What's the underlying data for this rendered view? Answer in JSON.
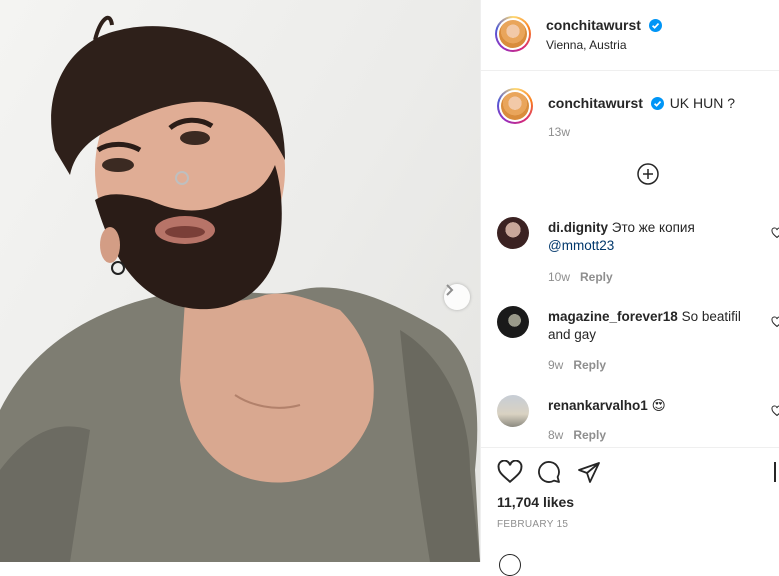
{
  "post": {
    "username": "conchitawurst",
    "location": "Vienna, Austria",
    "caption_text": "UK HUN ?",
    "caption_age": "13w",
    "likes": "11,704 likes",
    "date": "FEBRUARY 15"
  },
  "comments": [
    {
      "username": "di.dignity",
      "text": "Это же копия",
      "mention": "@mmott23",
      "age": "10w",
      "reply": "Reply"
    },
    {
      "username": "magazine_forever18",
      "text": "So beatifil and gay",
      "mention": "",
      "age": "9w",
      "reply": "Reply"
    },
    {
      "username": "renankarvalho1",
      "text": "😍",
      "mention": "",
      "age": "8w",
      "reply": "Reply"
    }
  ],
  "colors": {
    "verified": "#0095f6",
    "muted": "#8e8e8e",
    "link": "#00376b",
    "border": "#efefef"
  },
  "icons": [
    "verified-badge-icon",
    "add-comment-icon",
    "heart-icon",
    "comment-icon",
    "share-icon",
    "bookmark-icon",
    "next-arrow-icon"
  ]
}
